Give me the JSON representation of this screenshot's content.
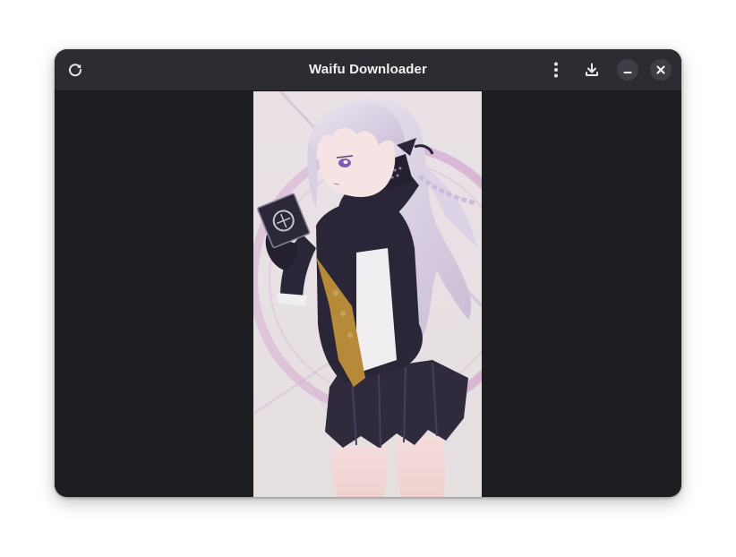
{
  "window": {
    "title": "Waifu Downloader"
  },
  "headerbar": {
    "refresh_icon": "refresh-icon",
    "menu_icon": "more-vertical-icon",
    "download_icon": "download-icon",
    "minimize_icon": "minimize-icon",
    "close_icon": "close-icon"
  },
  "image": {
    "subject": "anime girl with long lavender hair in black jacket and pleated skirt holding a card",
    "colors": {
      "background": "#e7dfe1",
      "hair": "#d9d0e2",
      "jacket": "#2a2638",
      "accent_ring": "#c98fc4"
    }
  },
  "theme": {
    "headerbar_bg": "#2c2c33",
    "content_bg": "#1e1e22",
    "button_bg": "#3e3e46",
    "text": "#f2f2f2"
  }
}
